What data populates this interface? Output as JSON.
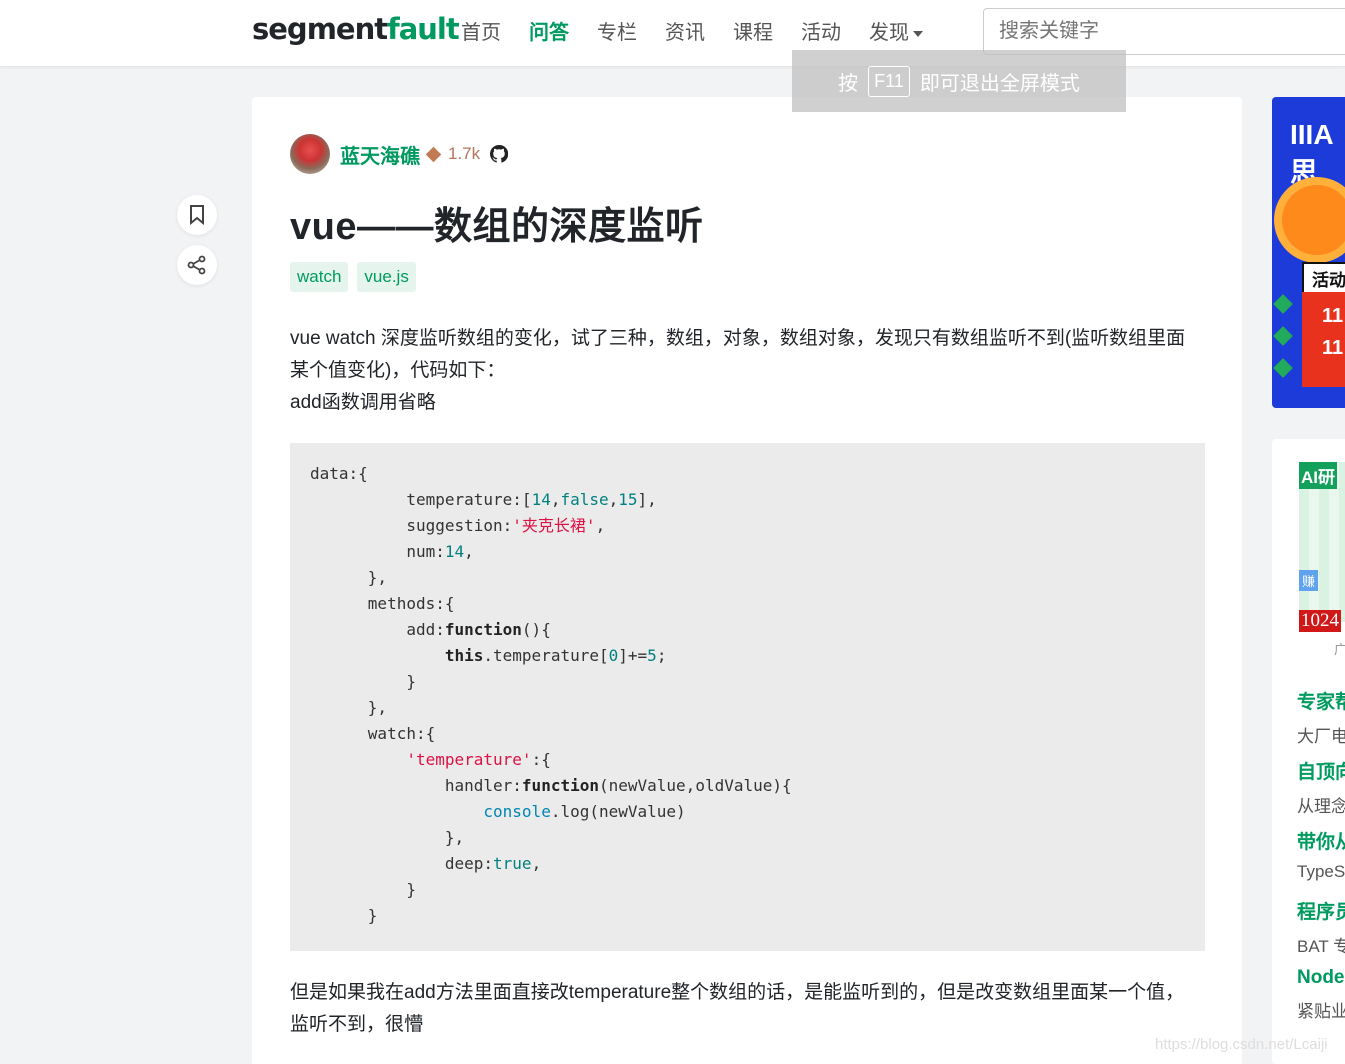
{
  "header": {
    "logo_a": "segment",
    "logo_b": "fault",
    "nav": [
      "首页",
      "问答",
      "专栏",
      "资讯",
      "课程",
      "活动",
      "发现"
    ],
    "search_placeholder": "搜索关键字"
  },
  "fullscreen_tip": {
    "prefix": "按",
    "key": "F11",
    "suffix": "即可退出全屏模式"
  },
  "article": {
    "author": "蓝天海礁",
    "reputation": "1.7k",
    "title": "vue——数组的深度监听",
    "tags": [
      "watch",
      "vue.js"
    ],
    "intro_line": "vue watch 深度监听数组的变化，试了三种，数组，对象，数组对象，发现只有数组监听不到(监听数组里面某个值变化)，代码如下：",
    "intro_line2": "add函数调用省略",
    "outro": "但是如果我在add方法里面直接改temperature整个数组的话，是能监听到的，但是改变数组里面某一个值，监听不到，很懵"
  },
  "sidebar": {
    "ad1": {
      "logo": "IIIA 思",
      "activity": "活动",
      "lines": [
        "11",
        "11"
      ]
    },
    "ad2": {
      "top": "AI研",
      "earn": "赚",
      "num": "1024"
    },
    "ad_label": "广",
    "items": [
      {
        "title": "专家帮",
        "desc": "大厂电"
      },
      {
        "title": "自顶向",
        "desc": "从理念"
      },
      {
        "title": "带你从",
        "desc": "TypeSc"
      },
      {
        "title": "程序员",
        "desc": "BAT 专"
      },
      {
        "title": "Node",
        "desc": "紧贴业"
      }
    ]
  },
  "watermark": "https://blog.csdn.net/Lcaiji",
  "colors": {
    "brand": "#009a61",
    "tag_bg": "#e5f5ee",
    "code_bg": "#ebebeb"
  }
}
